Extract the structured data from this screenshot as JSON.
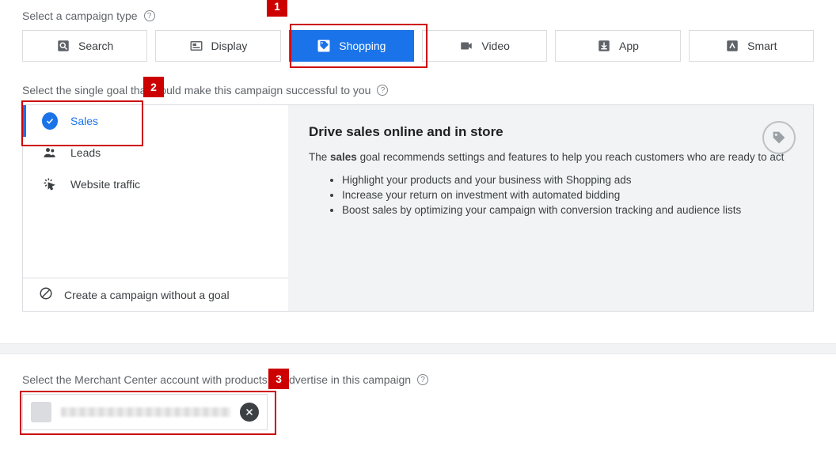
{
  "campaignTypeLabel": "Select a campaign type",
  "types": {
    "search": "Search",
    "display": "Display",
    "shopping": "Shopping",
    "video": "Video",
    "app": "App",
    "smart": "Smart"
  },
  "goalLabel": "Select the single goal that would make this campaign successful to you",
  "goals": {
    "sales": "Sales",
    "leads": "Leads",
    "traffic": "Website traffic"
  },
  "createWithoutGoal": "Create a campaign without a goal",
  "detail": {
    "title": "Drive sales online and in store",
    "pre": "The ",
    "bold": "sales",
    "post": " goal recommends settings and features to help you reach customers who are ready to act",
    "bullet1": "Highlight your products and your business with Shopping ads",
    "bullet2": "Increase your return on investment with automated bidding",
    "bullet3": "Boost sales by optimizing your campaign with conversion tracking and audience lists"
  },
  "merchantLabel": "Select the Merchant Center account with products to advertise in this campaign",
  "annotations": {
    "a1": "1",
    "a2": "2",
    "a3": "3"
  }
}
